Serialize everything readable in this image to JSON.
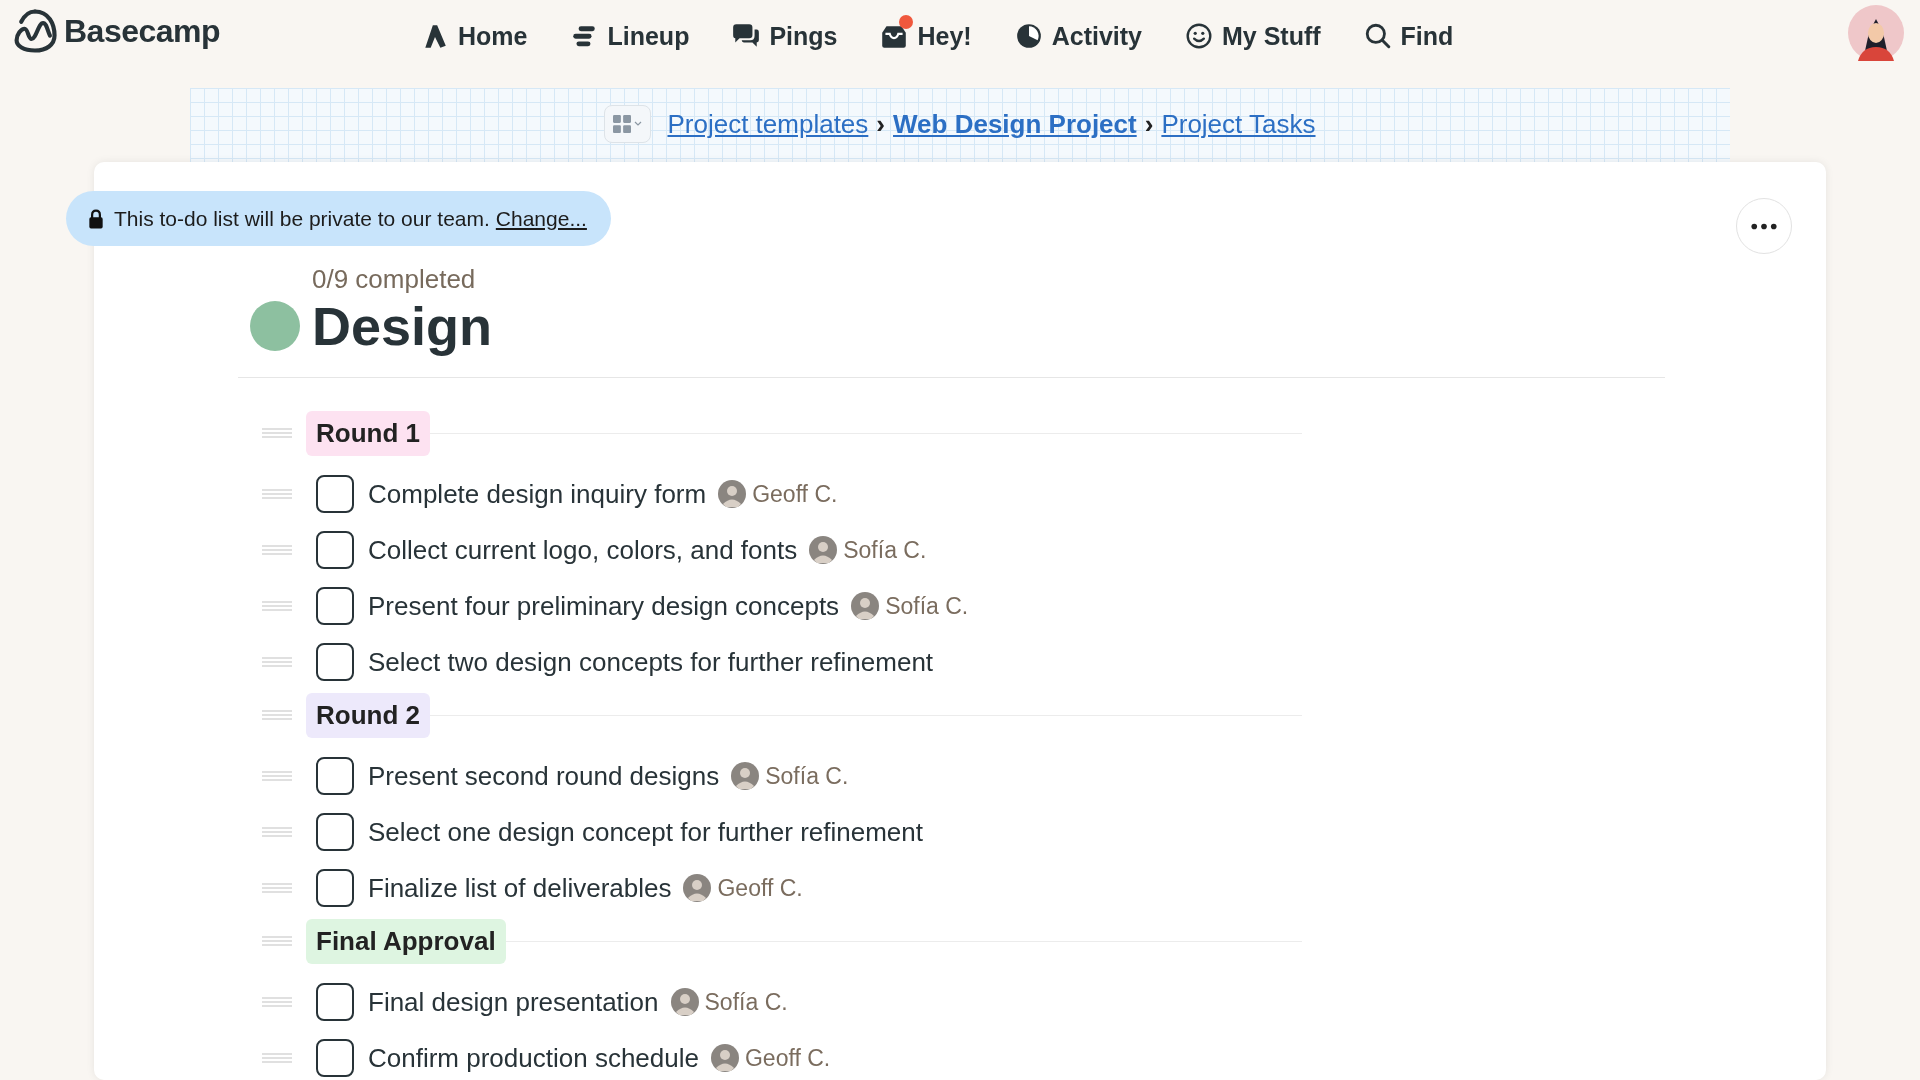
{
  "app": {
    "name": "Basecamp"
  },
  "nav": [
    {
      "label": "Home"
    },
    {
      "label": "Lineup"
    },
    {
      "label": "Pings"
    },
    {
      "label": "Hey!",
      "unread": true
    },
    {
      "label": "Activity"
    },
    {
      "label": "My Stuff"
    },
    {
      "label": "Find"
    }
  ],
  "breadcrumb": [
    {
      "kind": "link",
      "label": "Project templates",
      "bold": false
    },
    {
      "kind": "separator",
      "label": "›"
    },
    {
      "kind": "link",
      "label": "Web Design Project",
      "bold": true
    },
    {
      "kind": "separator",
      "label": "›"
    },
    {
      "kind": "link",
      "label": "Project Tasks",
      "bold": false
    }
  ],
  "privacy_notice": {
    "text": "This to-do list will be private to our team.",
    "link": "Change..."
  },
  "todolist": {
    "progress": "0/9 completed",
    "title": "Design",
    "color": "#8dc0a0",
    "groups": [
      {
        "title": "Round 1",
        "color": "#fde2f1",
        "todos": [
          {
            "text": "Complete design inquiry form",
            "checked": false,
            "assignee": "Geoff C."
          },
          {
            "text": "Collect current logo, colors, and fonts",
            "checked": false,
            "assignee": "Sofía C."
          },
          {
            "text": "Present four preliminary design concepts",
            "checked": false,
            "assignee": "Sofía C."
          },
          {
            "text": "Select two design concepts for further refinement",
            "checked": false
          }
        ]
      },
      {
        "title": "Round 2",
        "color": "#ede9fb",
        "todos": [
          {
            "text": "Present second round designs",
            "checked": false,
            "assignee": "Sofía C."
          },
          {
            "text": "Select one design concept for further refinement",
            "checked": false
          },
          {
            "text": "Finalize list of deliverables",
            "checked": false,
            "assignee": "Geoff C."
          }
        ]
      },
      {
        "title": "Final Approval",
        "color": "#def5e1",
        "todos": [
          {
            "text": "Final design presentation",
            "checked": false,
            "assignee": "Sofía C."
          },
          {
            "text": "Confirm production schedule",
            "checked": false,
            "assignee": "Geoff C."
          }
        ]
      }
    ]
  }
}
